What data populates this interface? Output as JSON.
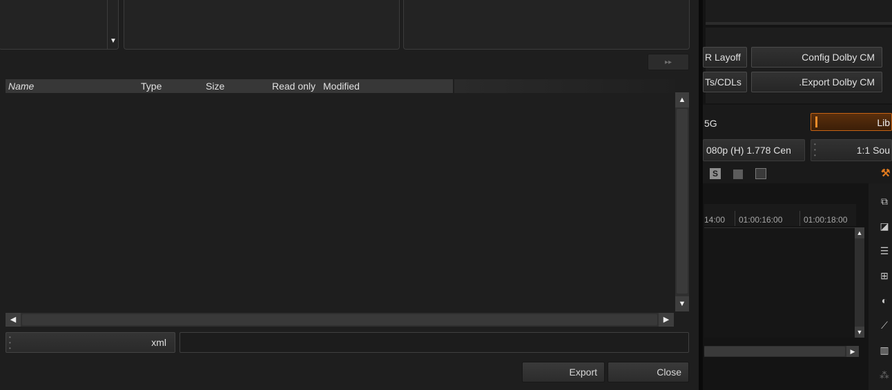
{
  "file_browser": {
    "columns": [
      "Name",
      "Type",
      "Size",
      "Read only",
      "Modified"
    ],
    "forward_glyph": "▸▸",
    "filter_value": "xml",
    "filename_value": "",
    "export_label": "Export",
    "close_label": "Close"
  },
  "right_panel": {
    "buttons": {
      "r_layoff": "R Layoff",
      "config_dolby": "Config Dolby CM",
      "ts_cdls": "Ts/CDLs",
      "export_dolby": ".Export Dolby CM"
    },
    "label_5g": "5G",
    "lib_label": "Lib",
    "format_value": "080p (H) 1.778 Cen",
    "scale_value": "1:1 Sou",
    "timecodes": [
      "14:00",
      "01:00:16:00",
      "01:00:18:00"
    ],
    "toolbar_icons": [
      "stereo-icon",
      "square-icon",
      "layout-icon",
      "wrench-icon"
    ],
    "side_icons": [
      "viewer-icon",
      "aspect-icon",
      "list-icon",
      "grid-icon",
      "color-icon",
      "curve-icon",
      "histogram-icon",
      "nodes-icon"
    ]
  },
  "colors": {
    "dialog_bg": "#1e1e1e",
    "header_bg": "#373737",
    "accent_orange": "#c86414"
  }
}
